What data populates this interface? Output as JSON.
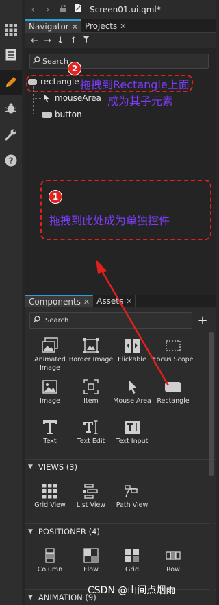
{
  "document": {
    "title": "Screen01.ui.qml*"
  },
  "rail": {
    "items": [
      {
        "name": "grid-icon",
        "active": false
      },
      {
        "name": "document-icon",
        "active": false
      },
      {
        "name": "pencil-icon",
        "active": true
      },
      {
        "name": "bug-icon",
        "active": false
      },
      {
        "name": "wrench-icon",
        "active": false
      },
      {
        "name": "help-icon",
        "active": false
      }
    ]
  },
  "nav_tabs": {
    "navigator": "Navigator",
    "projects": "Projects"
  },
  "navigator": {
    "search_placeholder": "Search",
    "tree": {
      "root": "rectangle",
      "child1": "mouseArea",
      "child2": "button"
    }
  },
  "annotations": {
    "badge1": "1",
    "badge2": "2",
    "text1": "拖拽到此处成为单独控件",
    "text2a": "拖拽到Rectangle上面",
    "text2b": "成为其子元素"
  },
  "lib_tabs": {
    "components": "Components",
    "assets": "Assets"
  },
  "library": {
    "search_placeholder": "Search",
    "add_label": "+",
    "basic": [
      {
        "label": "Animated Image",
        "icon": "animated-image-icon"
      },
      {
        "label": "Border Image",
        "icon": "border-image-icon"
      },
      {
        "label": "Flickable",
        "icon": "flickable-icon"
      },
      {
        "label": "Focus Scope",
        "icon": "focus-scope-icon"
      },
      {
        "label": "Image",
        "icon": "image-icon"
      },
      {
        "label": "Item",
        "icon": "item-icon"
      },
      {
        "label": "Mouse Area",
        "icon": "mouse-area-icon"
      },
      {
        "label": "Rectangle",
        "icon": "rectangle-icon"
      },
      {
        "label": "Text",
        "icon": "text-icon"
      },
      {
        "label": "Text Edit",
        "icon": "text-edit-icon"
      },
      {
        "label": "Text Input",
        "icon": "text-input-icon"
      }
    ],
    "views_header": "VIEWS (3)",
    "views": [
      {
        "label": "Grid View",
        "icon": "grid-view-icon"
      },
      {
        "label": "List View",
        "icon": "list-view-icon"
      },
      {
        "label": "Path View",
        "icon": "path-view-icon"
      }
    ],
    "positioner_header": "POSITIONER (4)",
    "positioner": [
      {
        "label": "Column",
        "icon": "column-icon"
      },
      {
        "label": "Flow",
        "icon": "flow-icon"
      },
      {
        "label": "Grid",
        "icon": "grid-positioner-icon"
      },
      {
        "label": "Row",
        "icon": "row-icon"
      }
    ],
    "animation_header": "ANIMATION (9)"
  },
  "watermark": "CSDN @山间点烟雨",
  "colors": {
    "accent": "#2f9fd6",
    "annotation_red": "#e0201e",
    "annotation_purple": "#7b3cf5",
    "active_tool": "#e48b13"
  }
}
